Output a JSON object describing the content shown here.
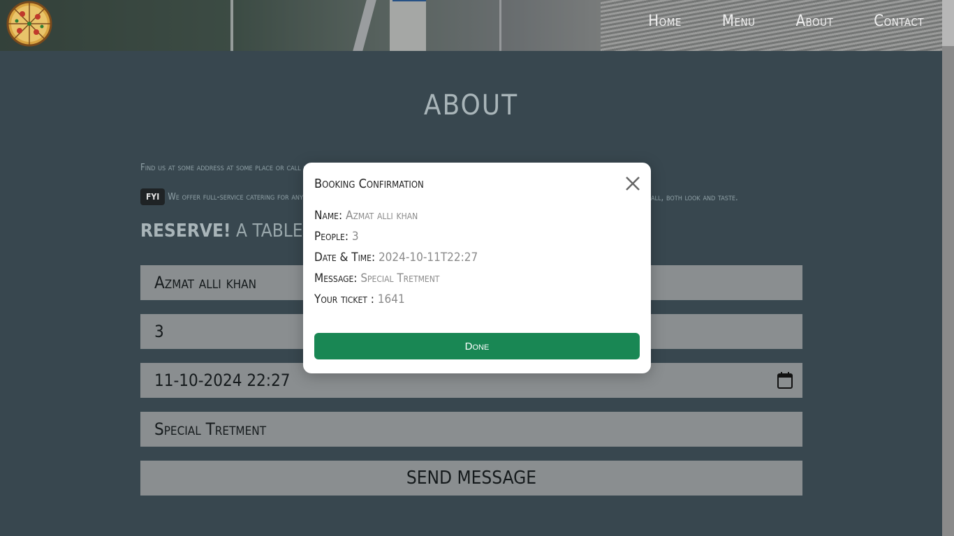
{
  "nav": {
    "home": "Home",
    "menu": "Menu",
    "about": "About",
    "contact": "Contact"
  },
  "about": {
    "title": "ABOUT",
    "address": "Find us at some address at some place or call us at 0",
    "fyi_badge": "FYI",
    "fyi_text": "We offer full-service catering for any event",
    "fyi_tail": "all, both look and taste.",
    "reserve_bold": "RESERVE!",
    "reserve_text": " A TABLE, ASK FOR TODAY"
  },
  "form": {
    "name": "Azmat alli khan",
    "people": "3",
    "datetime": "11-10-2024 22:27",
    "message": "Special Tretment",
    "send_label": "SEND MESSAGE"
  },
  "modal": {
    "title": "Booking Confirmation",
    "name_label": "Name:",
    "name_value": " Azmat alli khan",
    "people_label": "People:",
    "people_value": " 3",
    "datetime_label": "Date & Time:",
    "datetime_value": " 2024-10-11T22:27",
    "message_label": "Message:",
    "message_value": " Special Tretment",
    "ticket_label": "Your ticket :",
    "ticket_value": " 1641",
    "done_label": "Done"
  },
  "colors": {
    "done_button": "#198754",
    "page_background": "#38474f"
  }
}
